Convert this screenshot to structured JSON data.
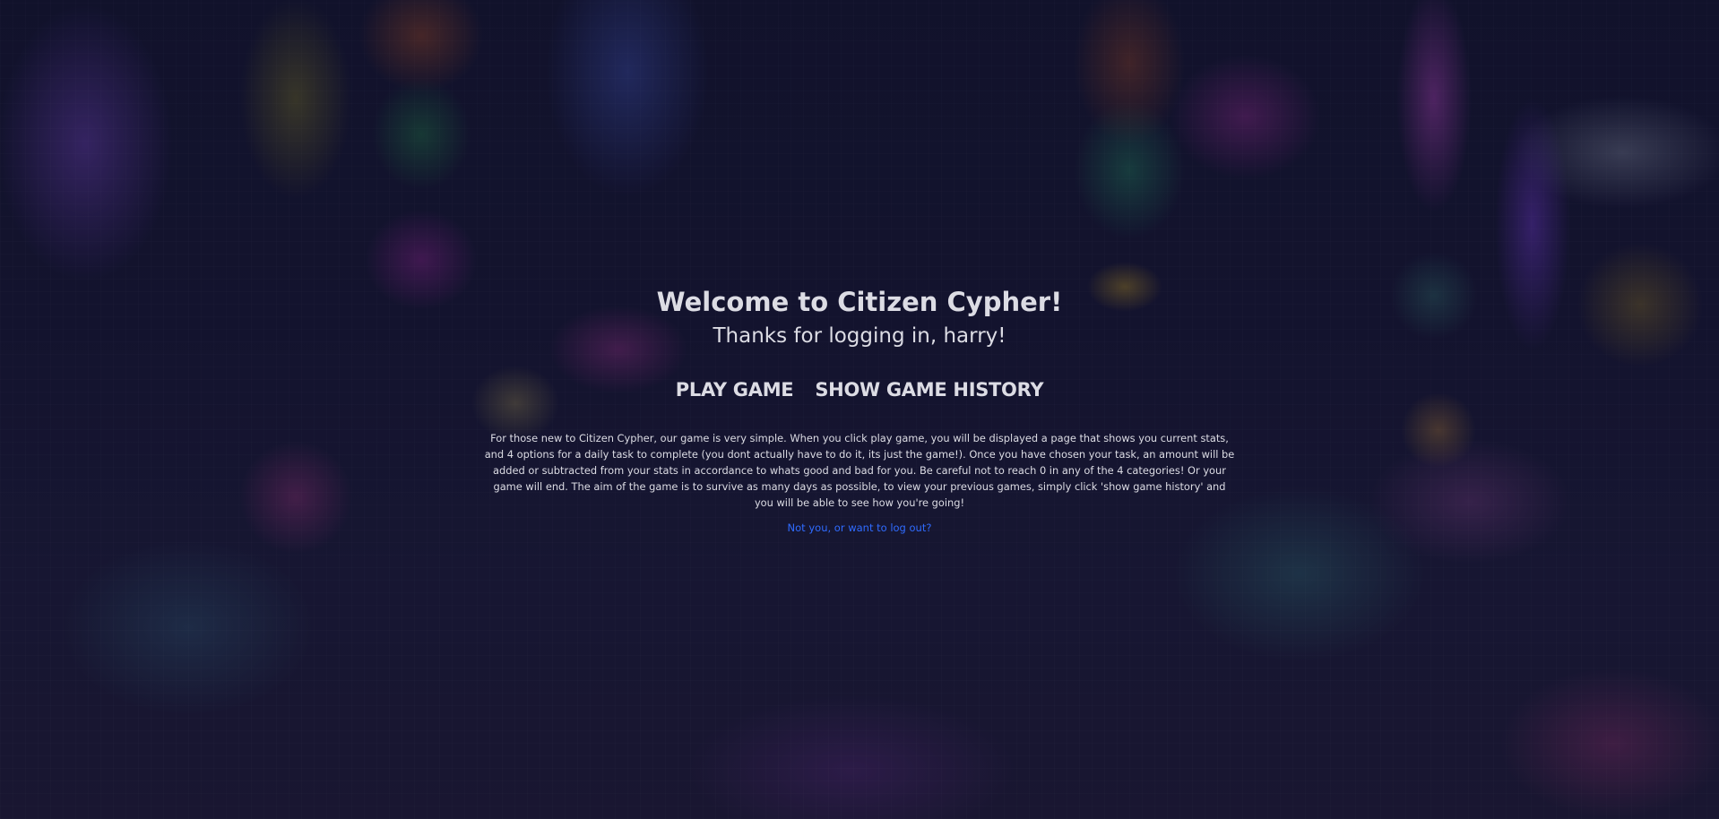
{
  "welcome": {
    "title": "Welcome to Citizen Cypher!",
    "subtitle": "Thanks for logging in, harry!"
  },
  "actions": {
    "play_game": "PLAY GAME",
    "show_history": "SHOW GAME HISTORY"
  },
  "description": "For those new to Citizen Cypher, our game is very simple. When you click play game, you will be displayed a page that shows you current stats, and 4 options for a daily task to complete (you dont actually have to do it, its just the game!). Once you have chosen your task, an amount will be added or subtracted from your stats in accordance to whats good and bad for you. Be careful not to reach 0 in any of the 4 categories! Or your game will end. The aim of the game is to survive as many days as possible, to view your previous games, simply click 'show game history' and you will be able to see how you're going!",
  "logout": {
    "label": "Not you, or want to log out?"
  },
  "colors": {
    "text": "#dcdce4",
    "link": "#2f6bff",
    "background": "#161634"
  }
}
